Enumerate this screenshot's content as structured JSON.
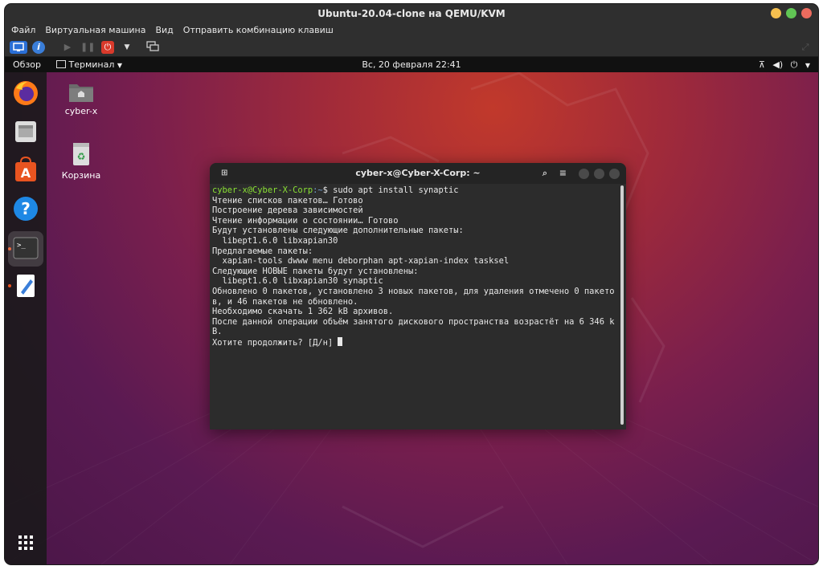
{
  "window": {
    "title": "Ubuntu-20.04-clone на QEMU/KVM",
    "colors": {
      "close": "#ec6b5e",
      "min": "#f5bf4f",
      "max": "#61c554"
    }
  },
  "menu": [
    "Файл",
    "Виртуальная машина",
    "Вид",
    "Отправить комбинацию клавиш"
  ],
  "toolbar_icons": [
    "monitor-icon",
    "info-icon",
    "play-icon",
    "pause-icon",
    "power-icon",
    "dropdown-icon",
    "snapshot-icon",
    "fullscreen-icon"
  ],
  "guest": {
    "activities": "Обзор",
    "app_menu": "Терминал",
    "clock": "Вс, 20 февраля  22:41",
    "tray_icons": [
      "network-icon",
      "volume-icon",
      "power-icon",
      "chevron-down-icon"
    ]
  },
  "dock": [
    "firefox-icon",
    "files-icon",
    "software-icon",
    "help-icon",
    "terminal-icon",
    "text-editor-icon",
    "app-grid-icon"
  ],
  "desktop_icons": [
    {
      "label": "cyber-x",
      "icon": "home-folder-icon"
    },
    {
      "label": "Корзина",
      "icon": "trash-icon"
    }
  ],
  "terminal": {
    "title": "cyber-x@Cyber-X-Corp: ~",
    "prompt_user": "cyber-x@Cyber-X-Corp",
    "prompt_path": ":~",
    "prompt_sign": "$ ",
    "command": "sudo apt install synaptic",
    "lines": [
      "Чтение списков пакетов… Готово",
      "Построение дерева зависимостей",
      "Чтение информации о состоянии… Готово",
      "Будут установлены следующие дополнительные пакеты:",
      "  libept1.6.0 libxapian30",
      "Предлагаемые пакеты:",
      "  xapian-tools dwww menu deborphan apt-xapian-index tasksel",
      "Следующие НОВЫЕ пакеты будут установлены:",
      "  libept1.6.0 libxapian30 synaptic",
      "Обновлено 0 пакетов, установлено 3 новых пакетов, для удаления отмечено 0 пакето",
      "в, и 46 пакетов не обновлено.",
      "Необходимо скачать 1 362 kB архивов.",
      "После данной операции объём занятого дискового пространства возрастёт на 6 346 k",
      "B.",
      "Хотите продолжить? [Д/н] "
    ]
  }
}
